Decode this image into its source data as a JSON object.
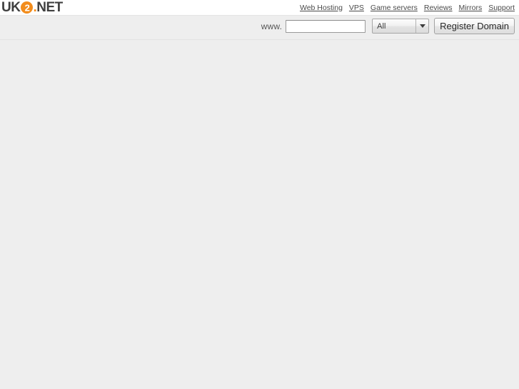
{
  "header": {
    "logo": {
      "part1": "UK",
      "badge": "2",
      "dot": ".",
      "part2": "NET",
      "accent_color": "#f28c1c"
    },
    "nav": [
      {
        "label": "Web Hosting",
        "name": "nav-web-hosting"
      },
      {
        "label": "VPS",
        "name": "nav-vps"
      },
      {
        "label": "Game servers",
        "name": "nav-game-servers"
      },
      {
        "label": "Reviews",
        "name": "nav-reviews"
      },
      {
        "label": "Mirrors",
        "name": "nav-mirrors"
      },
      {
        "label": "Support",
        "name": "nav-support"
      }
    ]
  },
  "search": {
    "prefix_label": "www.",
    "domain_value": "",
    "domain_placeholder": "",
    "tld_selected": "All",
    "tld_options": [
      "All"
    ],
    "register_label": "Register Domain"
  },
  "content": {
    "body_text": ""
  },
  "colors": {
    "page_background": "#eeeeee",
    "header_background": "#ffffff",
    "brand_orange": "#f28c1c",
    "link_color": "#4a4a4a"
  }
}
